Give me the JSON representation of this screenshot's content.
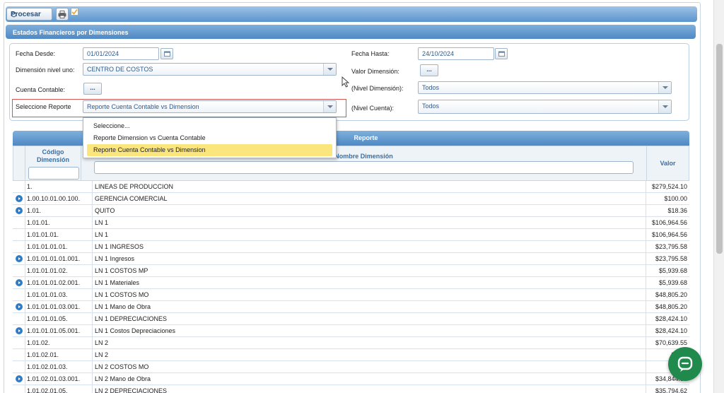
{
  "toolbar": {
    "procesar_label": "Procesar"
  },
  "section": {
    "title": "Estados Financieros por Dimensiones"
  },
  "filters": {
    "fecha_desde_label": "Fecha Desde:",
    "fecha_desde_value": "01/01/2024",
    "fecha_hasta_label": "Fecha Hasta:",
    "fecha_hasta_value": "24/10/2024",
    "dimension_label": "Dimensión nivel uno:",
    "dimension_value": "CENTRO DE COSTOS",
    "valor_dimension_label": "Valor Dimensión:",
    "cuenta_contable_label": "Cuenta Contable:",
    "nivel_dimension_label": "(Nivel Dimensión):",
    "nivel_dimension_value": "Todos",
    "seleccione_reporte_label": "Seleccione Reporte",
    "seleccione_reporte_value": "Reporte Cuenta Contable vs Dimension",
    "nivel_cuenta_label": "(Nivel Cuenta):",
    "nivel_cuenta_value": "Todos",
    "dots_label": "..."
  },
  "dropdown": {
    "options": [
      "Seleccione...",
      "Reporte Dimension vs Cuenta Contable",
      "Reporte Cuenta Contable vs Dimension"
    ],
    "selected_index": 2
  },
  "grid": {
    "title": "Reporte",
    "col_codigo": "Código Dimensión",
    "col_nombre": "Nombre Dimensión",
    "col_valor": "Valor",
    "rows": [
      {
        "icon": false,
        "codigo": "1.",
        "nombre": "LINEAS DE PRODUCCION",
        "valor": "$279,524.10"
      },
      {
        "icon": true,
        "codigo": "1.00.10.01.00.100.",
        "nombre": "GERENCIA COMERCIAL",
        "valor": "$100.00"
      },
      {
        "icon": true,
        "codigo": "1.01.",
        "nombre": "QUITO",
        "valor": "$18.36"
      },
      {
        "icon": false,
        "codigo": "1.01.01.",
        "nombre": "LN 1",
        "valor": "$106,964.56"
      },
      {
        "icon": false,
        "codigo": "1.01.01.01.",
        "nombre": "LN 1",
        "valor": "$106,964.56"
      },
      {
        "icon": false,
        "codigo": "1.01.01.01.01.",
        "nombre": "LN 1 INGRESOS",
        "valor": "$23,795.58"
      },
      {
        "icon": true,
        "codigo": "1.01.01.01.01.001.",
        "nombre": "LN 1 Ingresos",
        "valor": "$23,795.58"
      },
      {
        "icon": false,
        "codigo": "1.01.01.01.02.",
        "nombre": "LN 1 COSTOS MP",
        "valor": "$5,939.68"
      },
      {
        "icon": true,
        "codigo": "1.01.01.01.02.001.",
        "nombre": "LN 1 Materiales",
        "valor": "$5,939.68"
      },
      {
        "icon": false,
        "codigo": "1.01.01.01.03.",
        "nombre": "LN 1 COSTOS MO",
        "valor": "$48,805.20"
      },
      {
        "icon": true,
        "codigo": "1.01.01.01.03.001.",
        "nombre": "LN 1 Mano de Obra",
        "valor": "$48,805.20"
      },
      {
        "icon": false,
        "codigo": "1.01.01.01.05.",
        "nombre": "LN 1 DEPRECIACIONES",
        "valor": "$28,424.10"
      },
      {
        "icon": true,
        "codigo": "1.01.01.01.05.001.",
        "nombre": "LN 1 Costos Depreciaciones",
        "valor": "$28,424.10"
      },
      {
        "icon": false,
        "codigo": "1.01.02.",
        "nombre": "LN 2",
        "valor": "$70,639.55"
      },
      {
        "icon": false,
        "codigo": "1.01.02.01.",
        "nombre": "LN 2",
        "valor": "$70,6"
      },
      {
        "icon": false,
        "codigo": "1.01.02.01.03.",
        "nombre": "LN 2 COSTOS MO",
        "valor": "$34,8"
      },
      {
        "icon": true,
        "codigo": "1.01.02.01.03.001.",
        "nombre": "LN 2 Mano de Obra",
        "valor": "$34,844.93"
      },
      {
        "icon": false,
        "codigo": "1.01.02.01.05.",
        "nombre": "LN 2 DEPRECIACIONES",
        "valor": "$35,794.62"
      }
    ]
  }
}
